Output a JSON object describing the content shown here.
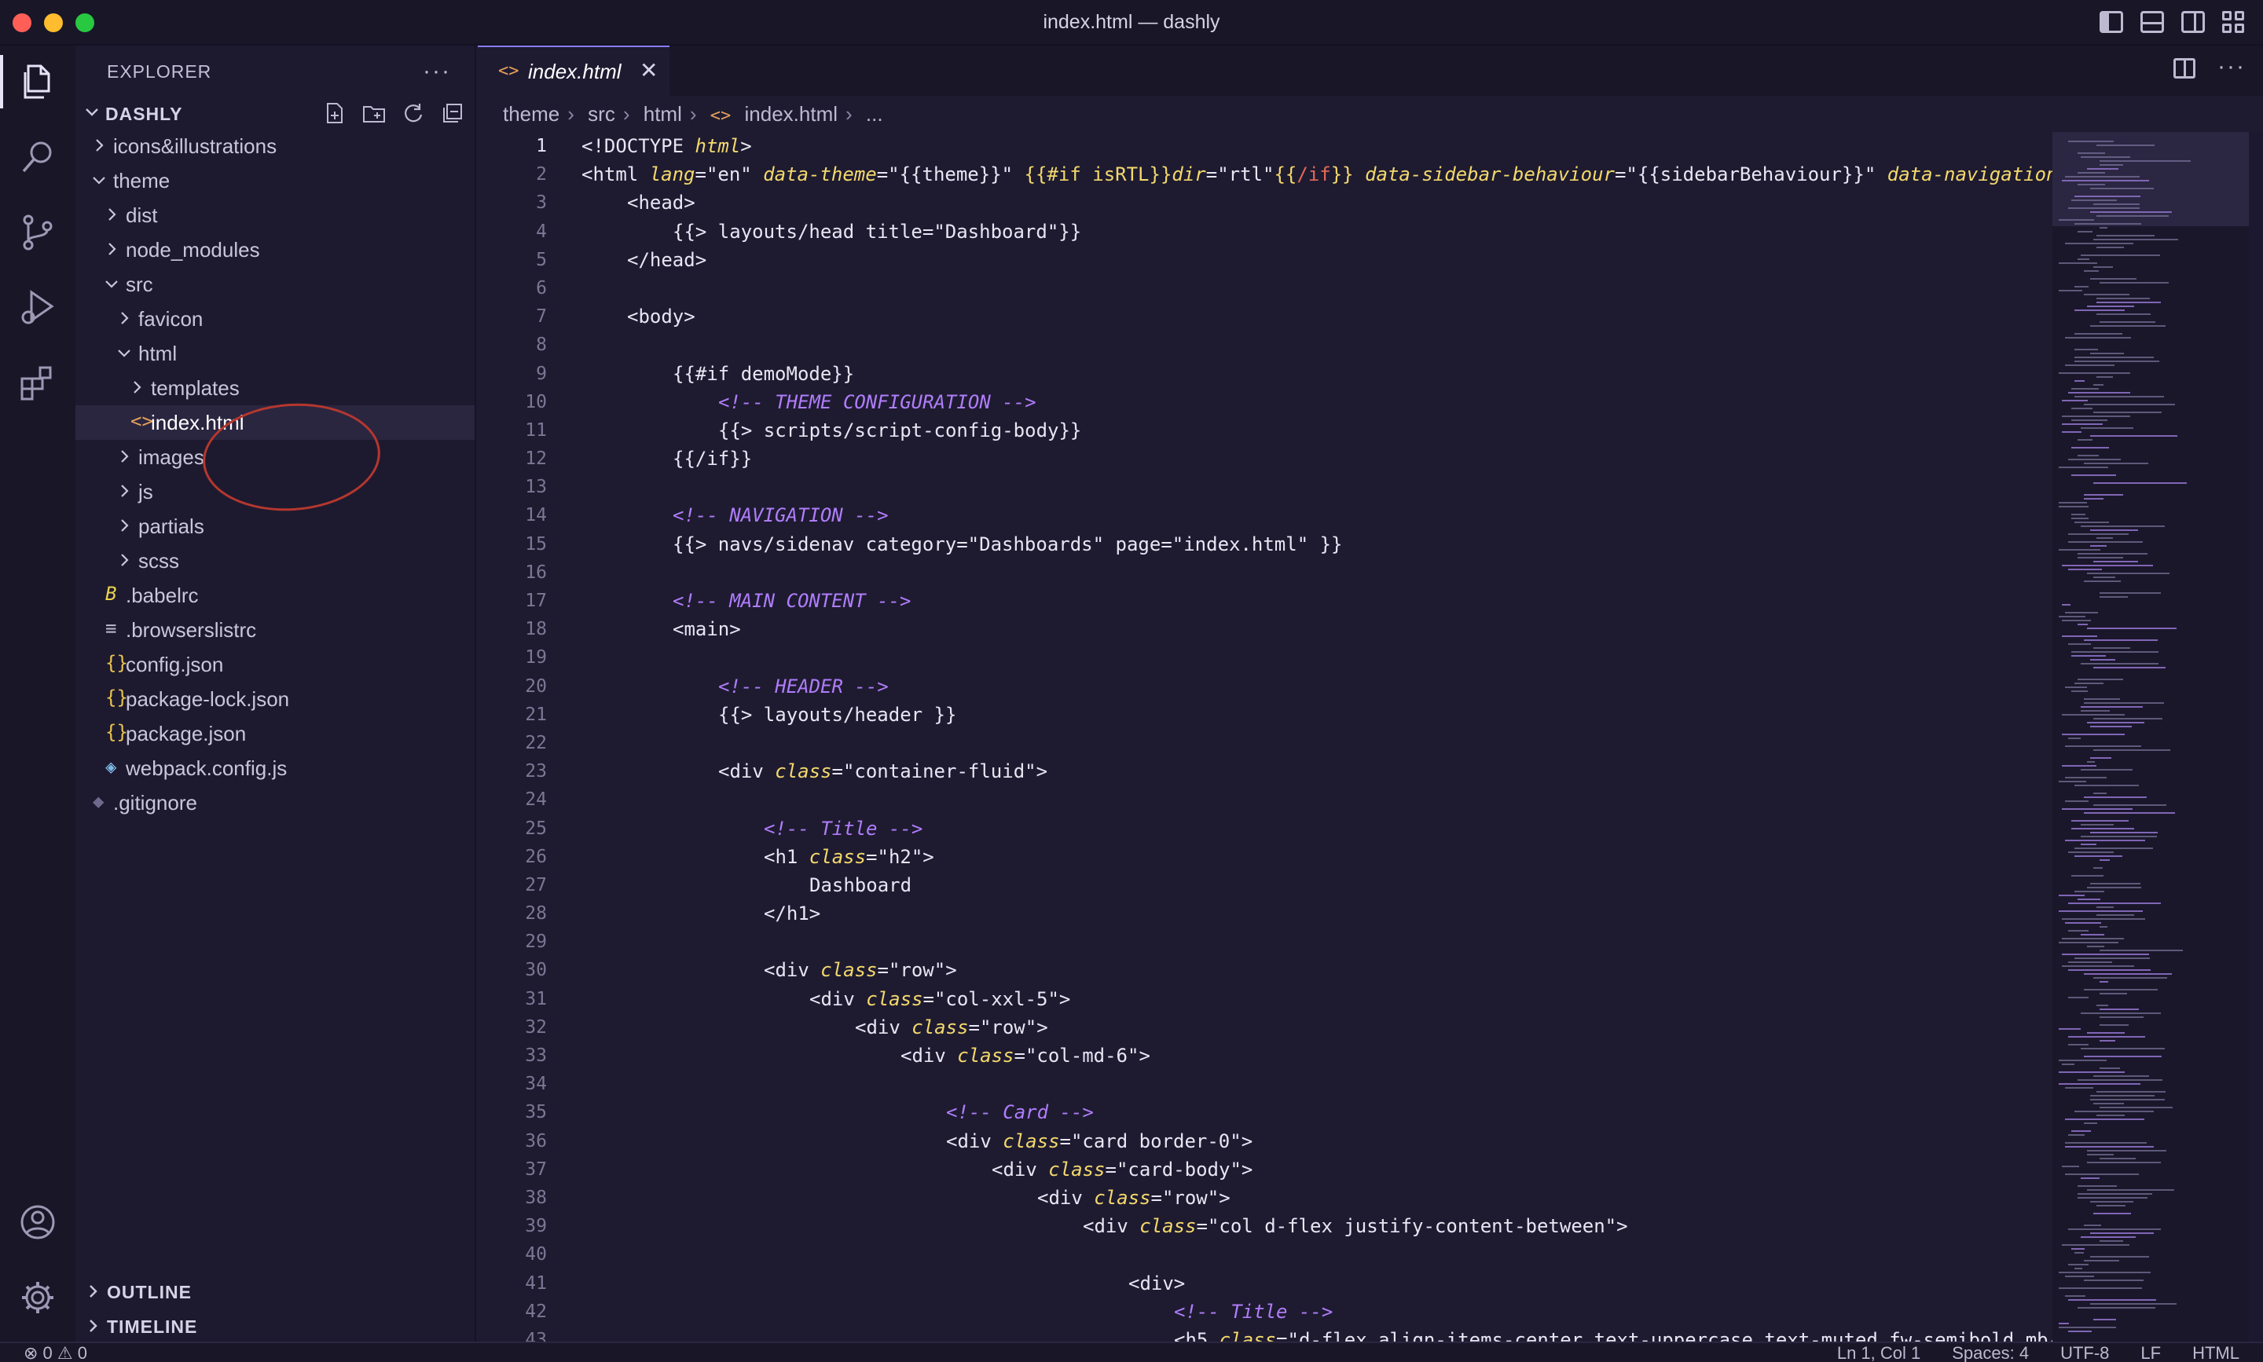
{
  "window": {
    "title": "index.html — dashly"
  },
  "explorer": {
    "header": "EXPLORER",
    "more": "···",
    "workspace": "DASHLY",
    "tree": [
      {
        "name": "icons&illustrations",
        "type": "folder",
        "depth": 0,
        "open": false
      },
      {
        "name": "theme",
        "type": "folder",
        "depth": 0,
        "open": true
      },
      {
        "name": "dist",
        "type": "folder",
        "depth": 1,
        "open": false
      },
      {
        "name": "node_modules",
        "type": "folder",
        "depth": 1,
        "open": false
      },
      {
        "name": "src",
        "type": "folder",
        "depth": 1,
        "open": true
      },
      {
        "name": "favicon",
        "type": "folder",
        "depth": 2,
        "open": false
      },
      {
        "name": "html",
        "type": "folder",
        "depth": 2,
        "open": true
      },
      {
        "name": "templates",
        "type": "folder",
        "depth": 3,
        "open": false
      },
      {
        "name": "index.html",
        "type": "html",
        "depth": 3,
        "selected": true
      },
      {
        "name": "images",
        "type": "folder",
        "depth": 2,
        "open": false
      },
      {
        "name": "js",
        "type": "folder",
        "depth": 2,
        "open": false
      },
      {
        "name": "partials",
        "type": "folder",
        "depth": 2,
        "open": false
      },
      {
        "name": "scss",
        "type": "folder",
        "depth": 2,
        "open": false
      },
      {
        "name": ".babelrc",
        "type": "babel",
        "depth": 1
      },
      {
        "name": ".browserslistrc",
        "type": "text",
        "depth": 1
      },
      {
        "name": "config.json",
        "type": "json",
        "depth": 1
      },
      {
        "name": "package-lock.json",
        "type": "json",
        "depth": 1
      },
      {
        "name": "package.json",
        "type": "json",
        "depth": 1
      },
      {
        "name": "webpack.config.js",
        "type": "webpack",
        "depth": 1
      },
      {
        "name": ".gitignore",
        "type": "git",
        "depth": 0
      }
    ],
    "outline": "OUTLINE",
    "timeline": "TIMELINE"
  },
  "tabs": [
    {
      "label": "index.html",
      "close": "✕"
    }
  ],
  "breadcrumb": [
    "theme",
    "src",
    "html",
    "index.html",
    "..."
  ],
  "editor": {
    "current_line": 1,
    "lines": [
      {
        "n": "1",
        "i": 0,
        "parts": [
          [
            "t",
            "<!DOCTYPE "
          ],
          [
            "a",
            "html"
          ],
          [
            "t",
            ">"
          ]
        ]
      },
      {
        "n": "2",
        "i": 0,
        "parts": [
          [
            "t",
            "<html "
          ],
          [
            "a",
            "lang"
          ],
          [
            "t",
            "=\"en\" "
          ],
          [
            "a",
            "data-theme"
          ],
          [
            "t",
            "=\"{{theme}}\" "
          ],
          [
            "h",
            "{{#if isRTL}}"
          ],
          [
            "a",
            "dir"
          ],
          [
            "t",
            "=\"rtl\""
          ],
          [
            "h",
            "{{"
          ],
          [
            "r",
            "/if"
          ],
          [
            "h",
            "}}"
          ],
          [
            "t",
            " "
          ],
          [
            "a",
            "data-sidebar-behaviour"
          ],
          [
            "t",
            "=\"{{sidebarBehaviour}}\" "
          ],
          [
            "a",
            "data-navigation"
          ]
        ]
      },
      {
        "n": "3",
        "i": 1,
        "parts": [
          [
            "t",
            "<head>"
          ]
        ]
      },
      {
        "n": "4",
        "i": 2,
        "parts": [
          [
            "t",
            "{{> layouts/head title=\"Dashboard\"}}"
          ]
        ]
      },
      {
        "n": "5",
        "i": 1,
        "parts": [
          [
            "t",
            "</head>"
          ]
        ]
      },
      {
        "n": "6",
        "i": 0,
        "parts": []
      },
      {
        "n": "7",
        "i": 1,
        "parts": [
          [
            "t",
            "<body>"
          ]
        ]
      },
      {
        "n": "8",
        "i": 0,
        "parts": []
      },
      {
        "n": "9",
        "i": 2,
        "parts": [
          [
            "t",
            "{{#if demoMode}}"
          ]
        ]
      },
      {
        "n": "10",
        "i": 3,
        "parts": [
          [
            "c",
            "<!-- THEME CONFIGURATION -->"
          ]
        ]
      },
      {
        "n": "11",
        "i": 3,
        "parts": [
          [
            "t",
            "{{> scripts/script-config-body}}"
          ]
        ]
      },
      {
        "n": "12",
        "i": 2,
        "parts": [
          [
            "t",
            "{{/if}}"
          ]
        ]
      },
      {
        "n": "13",
        "i": 0,
        "parts": []
      },
      {
        "n": "14",
        "i": 2,
        "parts": [
          [
            "c",
            "<!-- NAVIGATION -->"
          ]
        ]
      },
      {
        "n": "15",
        "i": 2,
        "parts": [
          [
            "t",
            "{{> navs/sidenav category=\"Dashboards\" page=\"index.html\" }}"
          ]
        ]
      },
      {
        "n": "16",
        "i": 0,
        "parts": []
      },
      {
        "n": "17",
        "i": 2,
        "parts": [
          [
            "c",
            "<!-- MAIN CONTENT -->"
          ]
        ]
      },
      {
        "n": "18",
        "i": 2,
        "parts": [
          [
            "t",
            "<main>"
          ]
        ]
      },
      {
        "n": "19",
        "i": 0,
        "parts": []
      },
      {
        "n": "20",
        "i": 3,
        "parts": [
          [
            "c",
            "<!-- HEADER -->"
          ]
        ]
      },
      {
        "n": "21",
        "i": 3,
        "parts": [
          [
            "t",
            "{{> layouts/header }}"
          ]
        ]
      },
      {
        "n": "22",
        "i": 0,
        "parts": []
      },
      {
        "n": "23",
        "i": 3,
        "parts": [
          [
            "t",
            "<div "
          ],
          [
            "a",
            "class"
          ],
          [
            "t",
            "=\"container-fluid\">"
          ]
        ]
      },
      {
        "n": "24",
        "i": 0,
        "parts": []
      },
      {
        "n": "25",
        "i": 4,
        "parts": [
          [
            "c",
            "<!-- Title -->"
          ]
        ]
      },
      {
        "n": "26",
        "i": 4,
        "parts": [
          [
            "t",
            "<h1 "
          ],
          [
            "a",
            "class"
          ],
          [
            "t",
            "=\"h2\">"
          ]
        ]
      },
      {
        "n": "27",
        "i": 5,
        "parts": [
          [
            "t",
            "Dashboard"
          ]
        ]
      },
      {
        "n": "28",
        "i": 4,
        "parts": [
          [
            "t",
            "</h1>"
          ]
        ]
      },
      {
        "n": "29",
        "i": 0,
        "parts": []
      },
      {
        "n": "30",
        "i": 4,
        "parts": [
          [
            "t",
            "<div "
          ],
          [
            "a",
            "class"
          ],
          [
            "t",
            "=\"row\">"
          ]
        ]
      },
      {
        "n": "31",
        "i": 5,
        "parts": [
          [
            "t",
            "<div "
          ],
          [
            "a",
            "class"
          ],
          [
            "t",
            "=\"col-xxl-5\">"
          ]
        ]
      },
      {
        "n": "32",
        "i": 6,
        "parts": [
          [
            "t",
            "<div "
          ],
          [
            "a",
            "class"
          ],
          [
            "t",
            "=\"row\">"
          ]
        ]
      },
      {
        "n": "33",
        "i": 7,
        "parts": [
          [
            "t",
            "<div "
          ],
          [
            "a",
            "class"
          ],
          [
            "t",
            "=\"col-md-6\">"
          ]
        ]
      },
      {
        "n": "34",
        "i": 0,
        "parts": []
      },
      {
        "n": "35",
        "i": 8,
        "parts": [
          [
            "c",
            "<!-- Card -->"
          ]
        ]
      },
      {
        "n": "36",
        "i": 8,
        "parts": [
          [
            "t",
            "<div "
          ],
          [
            "a",
            "class"
          ],
          [
            "t",
            "=\"card border-0\">"
          ]
        ]
      },
      {
        "n": "37",
        "i": 9,
        "parts": [
          [
            "t",
            "<div "
          ],
          [
            "a",
            "class"
          ],
          [
            "t",
            "=\"card-body\">"
          ]
        ]
      },
      {
        "n": "38",
        "i": 10,
        "parts": [
          [
            "t",
            "<div "
          ],
          [
            "a",
            "class"
          ],
          [
            "t",
            "=\"row\">"
          ]
        ]
      },
      {
        "n": "39",
        "i": 11,
        "parts": [
          [
            "t",
            "<div "
          ],
          [
            "a",
            "class"
          ],
          [
            "t",
            "=\"col d-flex justify-content-between\">"
          ]
        ]
      },
      {
        "n": "40",
        "i": 0,
        "parts": []
      },
      {
        "n": "41",
        "i": 12,
        "parts": [
          [
            "t",
            "<div>"
          ]
        ]
      },
      {
        "n": "42",
        "i": 13,
        "parts": [
          [
            "c",
            "<!-- Title -->"
          ]
        ]
      },
      {
        "n": "43",
        "i": 13,
        "parts": [
          [
            "t",
            "<h5 "
          ],
          [
            "a",
            "class"
          ],
          [
            "t",
            "=\"d-flex align-items-center text-uppercase text-muted fw-semibold mb-"
          ]
        ]
      }
    ]
  },
  "status": {
    "problems": "⊗ 0 ⚠ 0",
    "position": "Ln 1, Col 1",
    "spaces": "Spaces: 4",
    "encoding": "UTF-8",
    "eol": "LF",
    "language": "HTML"
  },
  "colors": {
    "background": "#1e1b31",
    "accent": "#8b7cf6",
    "comment": "#b07dfa",
    "attribute": "#f4d96b",
    "annotation": "#b5372e"
  }
}
